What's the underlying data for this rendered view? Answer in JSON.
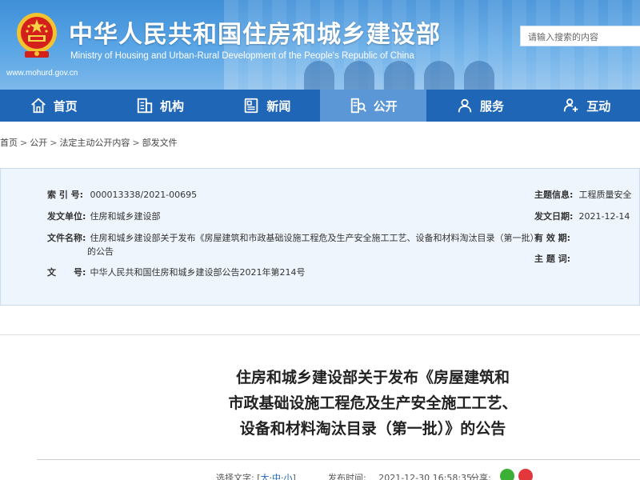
{
  "header": {
    "title_cn": "中华人民共和国住房和城乡建设部",
    "title_en": "Ministry of Housing and Urban-Rural Development of the People's Republic of China",
    "url": "www.mohurd.gov.cn",
    "search_placeholder": "请输入搜索的内容"
  },
  "nav": {
    "items": [
      {
        "label": "首页",
        "icon": "home-icon"
      },
      {
        "label": "机构",
        "icon": "building-icon"
      },
      {
        "label": "新闻",
        "icon": "news-icon"
      },
      {
        "label": "公开",
        "icon": "disclosure-icon"
      },
      {
        "label": "服务",
        "icon": "service-icon"
      },
      {
        "label": "互动",
        "icon": "interaction-icon"
      }
    ],
    "active": "公开"
  },
  "breadcrumb": {
    "items": [
      "首页",
      "公开",
      "法定主动公开内容",
      "部发文件"
    ],
    "separator": ">"
  },
  "meta": {
    "left": [
      {
        "label": "索 引 号:",
        "value": "000013338/2021-00695"
      },
      {
        "label": "发文单位:",
        "value": "住房和城乡建设部"
      },
      {
        "label": "文件名称:",
        "value": "住房和城乡建设部关于发布《房屋建筑和市政基础设施工程危及生产安全施工工艺、设备和材料淘汰目录（第一批）》",
        "value2": "的公告"
      },
      {
        "label": "文　　号:",
        "value": "中华人民共和国住房和城乡建设部公告2021年第214号"
      }
    ],
    "right": [
      {
        "label": "主题信息:",
        "value": "工程质量安全"
      },
      {
        "label": "发文日期:",
        "value": "2021-12-14"
      },
      {
        "label": "有 效 期:",
        "value": ""
      },
      {
        "label": "主 题 词:",
        "value": ""
      }
    ]
  },
  "article": {
    "title_lines": [
      "住房和城乡建设部关于发布《房屋建筑和",
      "市政基础设施工程危及生产安全施工工艺、",
      "设备和材料淘汰目录（第一批）》的公告"
    ],
    "font_label": "选择文字:",
    "font_sizes": [
      "大",
      "中",
      "小"
    ],
    "publish_label": "发布时间:",
    "publish_time": "2021-12-30 16:58:35",
    "share_label": "分享:"
  },
  "colors": {
    "nav_bg": "#1f66b6",
    "nav_active": "#5b96d6",
    "meta_bg": "#eef5fc",
    "wechat": "#3cb034",
    "weibo": "#e2383b"
  }
}
